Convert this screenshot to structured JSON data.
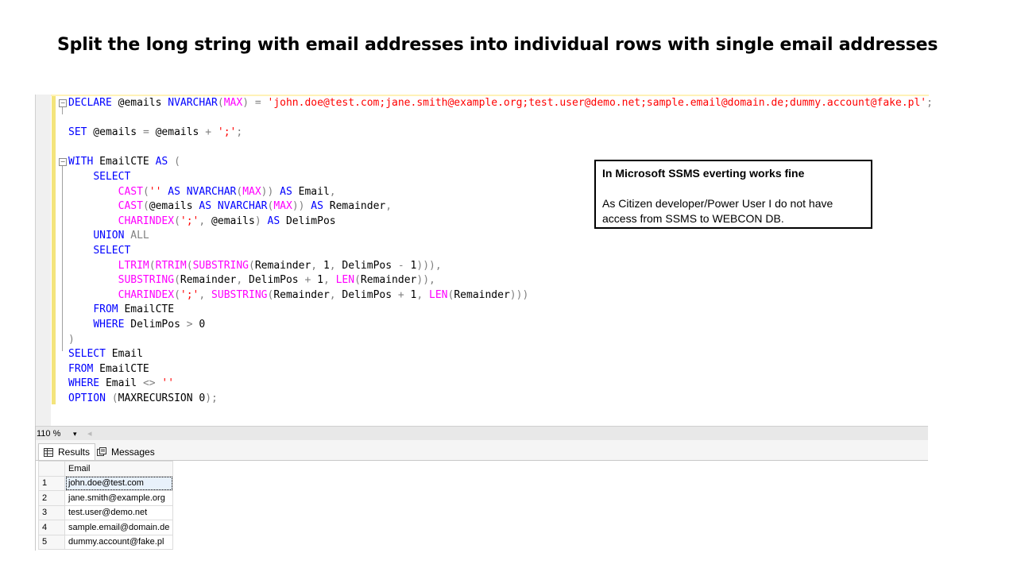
{
  "slide": {
    "title": "Split the long string with email addresses into individual rows with single email addresses"
  },
  "code": {
    "lines": [
      [
        {
          "t": "kw",
          "v": "DECLARE"
        },
        {
          "t": "tx",
          "v": " @emails "
        },
        {
          "t": "kw",
          "v": "NVARCHAR"
        },
        {
          "t": "gr",
          "v": "("
        },
        {
          "t": "fn",
          "v": "MAX"
        },
        {
          "t": "gr",
          "v": ")"
        },
        {
          "t": "tx",
          "v": " "
        },
        {
          "t": "gr",
          "v": "="
        },
        {
          "t": "tx",
          "v": " "
        },
        {
          "t": "str",
          "v": "'john.doe@test.com;jane.smith@example.org;test.user@demo.net;sample.email@domain.de;dummy.account@fake.pl'"
        },
        {
          "t": "gr",
          "v": ";"
        }
      ],
      [],
      [
        {
          "t": "kw",
          "v": "SET"
        },
        {
          "t": "tx",
          "v": " @emails "
        },
        {
          "t": "gr",
          "v": "="
        },
        {
          "t": "tx",
          "v": " @emails "
        },
        {
          "t": "gr",
          "v": "+"
        },
        {
          "t": "tx",
          "v": " "
        },
        {
          "t": "str",
          "v": "';'"
        },
        {
          "t": "gr",
          "v": ";"
        }
      ],
      [],
      [
        {
          "t": "kw",
          "v": "WITH"
        },
        {
          "t": "tx",
          "v": " EmailCTE "
        },
        {
          "t": "kw",
          "v": "AS"
        },
        {
          "t": "tx",
          "v": " "
        },
        {
          "t": "gr",
          "v": "("
        }
      ],
      [
        {
          "t": "tx",
          "v": "    "
        },
        {
          "t": "kw",
          "v": "SELECT"
        }
      ],
      [
        {
          "t": "tx",
          "v": "        "
        },
        {
          "t": "fn",
          "v": "CAST"
        },
        {
          "t": "gr",
          "v": "("
        },
        {
          "t": "str",
          "v": "''"
        },
        {
          "t": "tx",
          "v": " "
        },
        {
          "t": "kw",
          "v": "AS"
        },
        {
          "t": "tx",
          "v": " "
        },
        {
          "t": "kw",
          "v": "NVARCHAR"
        },
        {
          "t": "gr",
          "v": "("
        },
        {
          "t": "fn",
          "v": "MAX"
        },
        {
          "t": "gr",
          "v": "))"
        },
        {
          "t": "tx",
          "v": " "
        },
        {
          "t": "kw",
          "v": "AS"
        },
        {
          "t": "tx",
          "v": " Email"
        },
        {
          "t": "gr",
          "v": ","
        }
      ],
      [
        {
          "t": "tx",
          "v": "        "
        },
        {
          "t": "fn",
          "v": "CAST"
        },
        {
          "t": "gr",
          "v": "("
        },
        {
          "t": "tx",
          "v": "@emails "
        },
        {
          "t": "kw",
          "v": "AS"
        },
        {
          "t": "tx",
          "v": " "
        },
        {
          "t": "kw",
          "v": "NVARCHAR"
        },
        {
          "t": "gr",
          "v": "("
        },
        {
          "t": "fn",
          "v": "MAX"
        },
        {
          "t": "gr",
          "v": "))"
        },
        {
          "t": "tx",
          "v": " "
        },
        {
          "t": "kw",
          "v": "AS"
        },
        {
          "t": "tx",
          "v": " Remainder"
        },
        {
          "t": "gr",
          "v": ","
        }
      ],
      [
        {
          "t": "tx",
          "v": "        "
        },
        {
          "t": "fn",
          "v": "CHARINDEX"
        },
        {
          "t": "gr",
          "v": "("
        },
        {
          "t": "str",
          "v": "';'"
        },
        {
          "t": "gr",
          "v": ","
        },
        {
          "t": "tx",
          "v": " @emails"
        },
        {
          "t": "gr",
          "v": ")"
        },
        {
          "t": "tx",
          "v": " "
        },
        {
          "t": "kw",
          "v": "AS"
        },
        {
          "t": "tx",
          "v": " DelimPos"
        }
      ],
      [
        {
          "t": "tx",
          "v": "    "
        },
        {
          "t": "kw",
          "v": "UNION"
        },
        {
          "t": "tx",
          "v": " "
        },
        {
          "t": "gr",
          "v": "ALL"
        }
      ],
      [
        {
          "t": "tx",
          "v": "    "
        },
        {
          "t": "kw",
          "v": "SELECT"
        }
      ],
      [
        {
          "t": "tx",
          "v": "        "
        },
        {
          "t": "fn",
          "v": "LTRIM"
        },
        {
          "t": "gr",
          "v": "("
        },
        {
          "t": "fn",
          "v": "RTRIM"
        },
        {
          "t": "gr",
          "v": "("
        },
        {
          "t": "fn",
          "v": "SUBSTRING"
        },
        {
          "t": "gr",
          "v": "("
        },
        {
          "t": "tx",
          "v": "Remainder"
        },
        {
          "t": "gr",
          "v": ","
        },
        {
          "t": "tx",
          "v": " 1"
        },
        {
          "t": "gr",
          "v": ","
        },
        {
          "t": "tx",
          "v": " DelimPos "
        },
        {
          "t": "gr",
          "v": "-"
        },
        {
          "t": "tx",
          "v": " 1"
        },
        {
          "t": "gr",
          "v": "))),"
        }
      ],
      [
        {
          "t": "tx",
          "v": "        "
        },
        {
          "t": "fn",
          "v": "SUBSTRING"
        },
        {
          "t": "gr",
          "v": "("
        },
        {
          "t": "tx",
          "v": "Remainder"
        },
        {
          "t": "gr",
          "v": ","
        },
        {
          "t": "tx",
          "v": " DelimPos "
        },
        {
          "t": "gr",
          "v": "+"
        },
        {
          "t": "tx",
          "v": " 1"
        },
        {
          "t": "gr",
          "v": ","
        },
        {
          "t": "tx",
          "v": " "
        },
        {
          "t": "fn",
          "v": "LEN"
        },
        {
          "t": "gr",
          "v": "("
        },
        {
          "t": "tx",
          "v": "Remainder"
        },
        {
          "t": "gr",
          "v": ")),"
        }
      ],
      [
        {
          "t": "tx",
          "v": "        "
        },
        {
          "t": "fn",
          "v": "CHARINDEX"
        },
        {
          "t": "gr",
          "v": "("
        },
        {
          "t": "str",
          "v": "';'"
        },
        {
          "t": "gr",
          "v": ","
        },
        {
          "t": "tx",
          "v": " "
        },
        {
          "t": "fn",
          "v": "SUBSTRING"
        },
        {
          "t": "gr",
          "v": "("
        },
        {
          "t": "tx",
          "v": "Remainder"
        },
        {
          "t": "gr",
          "v": ","
        },
        {
          "t": "tx",
          "v": " DelimPos "
        },
        {
          "t": "gr",
          "v": "+"
        },
        {
          "t": "tx",
          "v": " 1"
        },
        {
          "t": "gr",
          "v": ","
        },
        {
          "t": "tx",
          "v": " "
        },
        {
          "t": "fn",
          "v": "LEN"
        },
        {
          "t": "gr",
          "v": "("
        },
        {
          "t": "tx",
          "v": "Remainder"
        },
        {
          "t": "gr",
          "v": ")))"
        }
      ],
      [
        {
          "t": "tx",
          "v": "    "
        },
        {
          "t": "kw",
          "v": "FROM"
        },
        {
          "t": "tx",
          "v": " EmailCTE"
        }
      ],
      [
        {
          "t": "tx",
          "v": "    "
        },
        {
          "t": "kw",
          "v": "WHERE"
        },
        {
          "t": "tx",
          "v": " DelimPos "
        },
        {
          "t": "gr",
          "v": ">"
        },
        {
          "t": "tx",
          "v": " 0"
        }
      ],
      [
        {
          "t": "gr",
          "v": ")"
        }
      ],
      [
        {
          "t": "kw",
          "v": "SELECT"
        },
        {
          "t": "tx",
          "v": " Email"
        }
      ],
      [
        {
          "t": "kw",
          "v": "FROM"
        },
        {
          "t": "tx",
          "v": " EmailCTE"
        }
      ],
      [
        {
          "t": "kw",
          "v": "WHERE"
        },
        {
          "t": "tx",
          "v": " Email "
        },
        {
          "t": "gr",
          "v": "<>"
        },
        {
          "t": "tx",
          "v": " "
        },
        {
          "t": "str",
          "v": "''"
        }
      ],
      [
        {
          "t": "kw",
          "v": "OPTION"
        },
        {
          "t": "tx",
          "v": " "
        },
        {
          "t": "gr",
          "v": "("
        },
        {
          "t": "tx",
          "v": "MAXRECURSION 0"
        },
        {
          "t": "gr",
          "v": ");"
        }
      ]
    ]
  },
  "note": {
    "heading": "In Microsoft SSMS everting works fine",
    "body": "As Citizen developer/Power User I do not have access from SSMS to WEBCON DB."
  },
  "zoom": {
    "value": "110 %",
    "arrow": "▾",
    "separator": "◂"
  },
  "tabs": [
    {
      "label": "Results",
      "icon": "grid-icon",
      "active": true
    },
    {
      "label": "Messages",
      "icon": "messages-icon",
      "active": false
    }
  ],
  "results": {
    "columns": [
      "Email"
    ],
    "rows": [
      {
        "n": "1",
        "email": "john.doe@test.com"
      },
      {
        "n": "2",
        "email": "jane.smith@example.org"
      },
      {
        "n": "3",
        "email": "test.user@demo.net"
      },
      {
        "n": "4",
        "email": "sample.email@domain.de"
      },
      {
        "n": "5",
        "email": "dummy.account@fake.pl"
      }
    ]
  },
  "colors": {
    "keyword": "#0000ff",
    "function": "#ff00ff",
    "string": "#ff0000",
    "operator": "#808080",
    "change_bar": "#f4e47c"
  }
}
